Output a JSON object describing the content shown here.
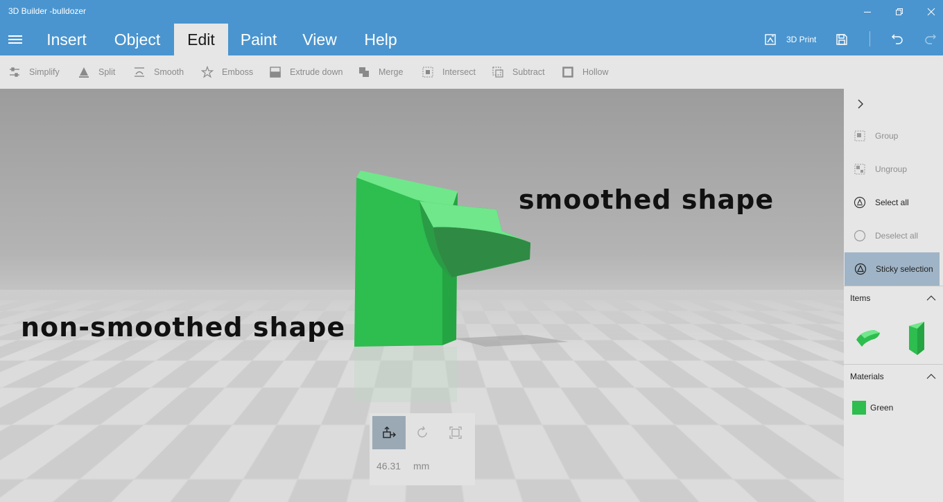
{
  "window": {
    "title": "3D Builder -bulldozer",
    "minimize_icon": "minimize-icon",
    "maximize_icon": "maximize-icon",
    "close_icon": "close-icon"
  },
  "menu": {
    "tabs": [
      {
        "label": "Insert"
      },
      {
        "label": "Object"
      },
      {
        "label": "Edit"
      },
      {
        "label": "Paint"
      },
      {
        "label": "View"
      },
      {
        "label": "Help"
      }
    ],
    "active_tab": "Edit",
    "print_label": "3D Print"
  },
  "toolbar": {
    "tools": [
      {
        "label": "Simplify",
        "icon": "simplify-icon"
      },
      {
        "label": "Split",
        "icon": "split-icon"
      },
      {
        "label": "Smooth",
        "icon": "smooth-icon"
      },
      {
        "label": "Emboss",
        "icon": "star-icon"
      },
      {
        "label": "Extrude down",
        "icon": "extrude-down-icon"
      },
      {
        "label": "Merge",
        "icon": "merge-icon"
      },
      {
        "label": "Intersect",
        "icon": "intersect-icon"
      },
      {
        "label": "Subtract",
        "icon": "subtract-icon"
      },
      {
        "label": "Hollow",
        "icon": "hollow-icon"
      }
    ]
  },
  "viewport": {
    "annotations": {
      "smoothed": "smoothed shape",
      "non_smoothed": "non-smoothed shape"
    },
    "gizmo": {
      "value": "46.31",
      "unit": "mm"
    }
  },
  "right_panel": {
    "actions": [
      {
        "label": "Group",
        "enabled": false
      },
      {
        "label": "Ungroup",
        "enabled": false
      },
      {
        "label": "Select all",
        "enabled": true
      },
      {
        "label": "Deselect all",
        "enabled": false
      },
      {
        "label": "Sticky selection",
        "enabled": true,
        "highlighted": true
      }
    ],
    "items_header": "Items",
    "materials_header": "Materials",
    "materials": [
      {
        "name": "Green",
        "color": "#2ebd4f"
      }
    ]
  },
  "colors": {
    "accent": "#4a95cf",
    "model_green": "#2ebd4f",
    "highlight": "#9fb4c6"
  }
}
